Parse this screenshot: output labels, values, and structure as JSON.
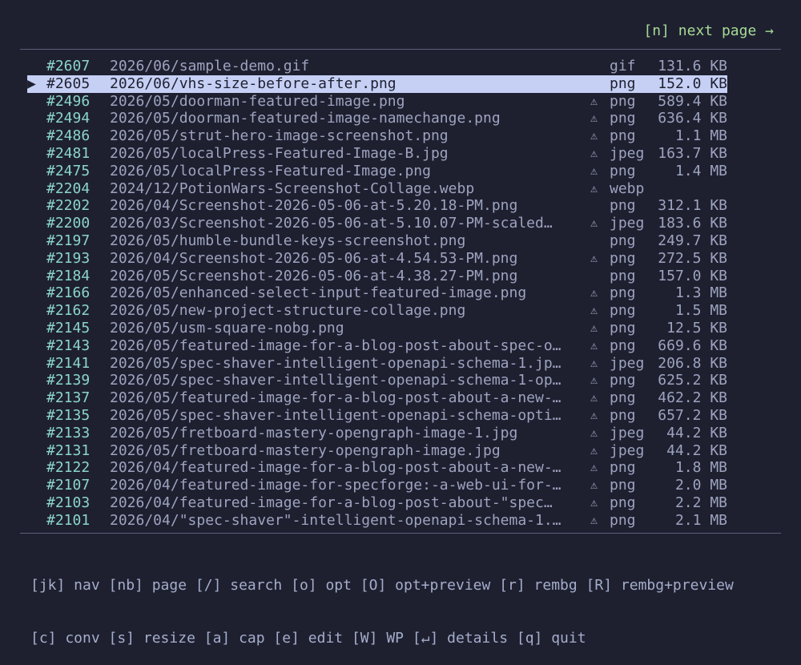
{
  "header": {
    "next_page": "[n] next page →"
  },
  "files": [
    {
      "id": "#2607",
      "path": "2026/06/sample-demo.gif",
      "warn": "",
      "ext": "gif",
      "size": "131.6 KB",
      "selected": false
    },
    {
      "id": "#2605",
      "path": "2026/06/vhs-size-before-after.png",
      "warn": "",
      "ext": "png",
      "size": "152.0 KB",
      "selected": true
    },
    {
      "id": "#2496",
      "path": "2026/05/doorman-featured-image.png",
      "warn": "⚠",
      "ext": "png",
      "size": "589.4 KB",
      "selected": false
    },
    {
      "id": "#2494",
      "path": "2026/05/doorman-featured-image-namechange.png",
      "warn": "⚠",
      "ext": "png",
      "size": "636.4 KB",
      "selected": false
    },
    {
      "id": "#2486",
      "path": "2026/05/strut-hero-image-screenshot.png",
      "warn": "⚠",
      "ext": "png",
      "size": "1.1 MB",
      "selected": false
    },
    {
      "id": "#2481",
      "path": "2026/05/localPress-Featured-Image-B.jpg",
      "warn": "⚠",
      "ext": "jpeg",
      "size": "163.7 KB",
      "selected": false
    },
    {
      "id": "#2475",
      "path": "2026/05/localPress-Featured-Image.png",
      "warn": "⚠",
      "ext": "png",
      "size": "1.4 MB",
      "selected": false
    },
    {
      "id": "#2204",
      "path": "2024/12/PotionWars-Screenshot-Collage.webp",
      "warn": "⚠",
      "ext": "webp",
      "size": "",
      "selected": false
    },
    {
      "id": "#2202",
      "path": "2026/04/Screenshot-2026-05-06-at-5.20.18-PM.png",
      "warn": "",
      "ext": "png",
      "size": "312.1 KB",
      "selected": false
    },
    {
      "id": "#2200",
      "path": "2026/03/Screenshot-2026-05-06-at-5.10.07-PM-scaled…",
      "warn": "⚠",
      "ext": "jpeg",
      "size": "183.6 KB",
      "selected": false
    },
    {
      "id": "#2197",
      "path": "2026/05/humble-bundle-keys-screenshot.png",
      "warn": "",
      "ext": "png",
      "size": "249.7 KB",
      "selected": false
    },
    {
      "id": "#2193",
      "path": "2026/04/Screenshot-2026-05-06-at-4.54.53-PM.png",
      "warn": "⚠",
      "ext": "png",
      "size": "272.5 KB",
      "selected": false
    },
    {
      "id": "#2184",
      "path": "2026/05/Screenshot-2026-05-06-at-4.38.27-PM.png",
      "warn": "",
      "ext": "png",
      "size": "157.0 KB",
      "selected": false
    },
    {
      "id": "#2166",
      "path": "2026/05/enhanced-select-input-featured-image.png",
      "warn": "⚠",
      "ext": "png",
      "size": "1.3 MB",
      "selected": false
    },
    {
      "id": "#2162",
      "path": "2026/05/new-project-structure-collage.png",
      "warn": "⚠",
      "ext": "png",
      "size": "1.5 MB",
      "selected": false
    },
    {
      "id": "#2145",
      "path": "2026/05/usm-square-nobg.png",
      "warn": "⚠",
      "ext": "png",
      "size": "12.5 KB",
      "selected": false
    },
    {
      "id": "#2143",
      "path": "2026/05/featured-image-for-a-blog-post-about-spec-o…",
      "warn": "⚠",
      "ext": "png",
      "size": "669.6 KB",
      "selected": false
    },
    {
      "id": "#2141",
      "path": "2026/05/spec-shaver-intelligent-openapi-schema-1.jp…",
      "warn": "⚠",
      "ext": "jpeg",
      "size": "206.8 KB",
      "selected": false
    },
    {
      "id": "#2139",
      "path": "2026/05/spec-shaver-intelligent-openapi-schema-1-op…",
      "warn": "⚠",
      "ext": "png",
      "size": "625.2 KB",
      "selected": false
    },
    {
      "id": "#2137",
      "path": "2026/05/featured-image-for-a-blog-post-about-a-new-…",
      "warn": "⚠",
      "ext": "png",
      "size": "462.2 KB",
      "selected": false
    },
    {
      "id": "#2135",
      "path": "2026/05/spec-shaver-intelligent-openapi-schema-opti…",
      "warn": "⚠",
      "ext": "png",
      "size": "657.2 KB",
      "selected": false
    },
    {
      "id": "#2133",
      "path": "2026/05/fretboard-mastery-opengraph-image-1.jpg",
      "warn": "⚠",
      "ext": "jpeg",
      "size": "44.2 KB",
      "selected": false
    },
    {
      "id": "#2131",
      "path": "2026/05/fretboard-mastery-opengraph-image.jpg",
      "warn": "⚠",
      "ext": "jpeg",
      "size": "44.2 KB",
      "selected": false
    },
    {
      "id": "#2122",
      "path": "2026/04/featured-image-for-a-blog-post-about-a-new-…",
      "warn": "⚠",
      "ext": "png",
      "size": "1.8 MB",
      "selected": false
    },
    {
      "id": "#2107",
      "path": "2026/04/featured-image-for-specforge:-a-web-ui-for-…",
      "warn": "⚠",
      "ext": "png",
      "size": "2.0 MB",
      "selected": false
    },
    {
      "id": "#2103",
      "path": "2026/04/featured-image-for-a-blog-post-about-\"spec…",
      "warn": "⚠",
      "ext": "png",
      "size": "2.2 MB",
      "selected": false
    },
    {
      "id": "#2101",
      "path": "2026/04/\"spec-shaver\"-intelligent-openapi-schema-1.…",
      "warn": "⚠",
      "ext": "png",
      "size": "2.1 MB",
      "selected": false
    }
  ],
  "cursor_glyph": "▶",
  "help": {
    "line1": "[jk] nav [nb] page [/] search [o] opt [O] opt+preview [r] rembg [R] rembg+preview",
    "line2": "[c] conv [s] resize [a] cap [e] edit [W] WP [↵] details [q] quit"
  },
  "colors": {
    "background": "#1e2030",
    "id": "#8bd5ca",
    "next_page": "#a6da95",
    "selection": "#c6d0f5",
    "text": "#9ea3bf"
  }
}
